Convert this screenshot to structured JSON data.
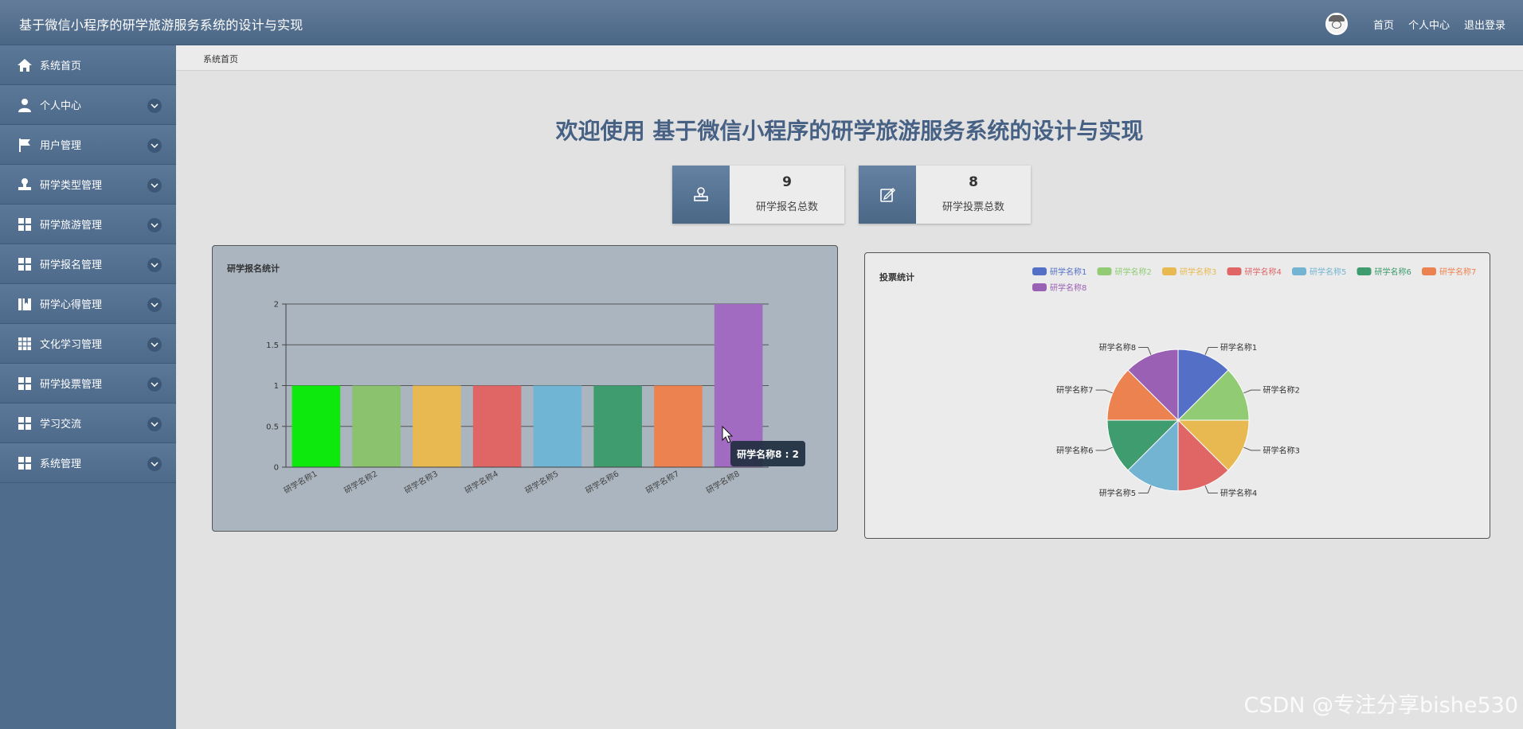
{
  "header": {
    "title": "基于微信小程序的研学旅游服务系统的设计与实现",
    "links": [
      "首页",
      "个人中心",
      "退出登录"
    ]
  },
  "sidebar": {
    "items": [
      {
        "label": "系统首页",
        "icon": "home-icon"
      },
      {
        "label": "个人中心",
        "icon": "user-icon"
      },
      {
        "label": "用户管理",
        "icon": "flag-icon"
      },
      {
        "label": "研学类型管理",
        "icon": "stamp-icon"
      },
      {
        "label": "研学旅游管理",
        "icon": "grid-icon"
      },
      {
        "label": "研学报名管理",
        "icon": "grid-icon"
      },
      {
        "label": "研学心得管理",
        "icon": "book-icon"
      },
      {
        "label": "文化学习管理",
        "icon": "grid9-icon"
      },
      {
        "label": "研学投票管理",
        "icon": "grid-icon"
      },
      {
        "label": "学习交流",
        "icon": "grid-icon"
      },
      {
        "label": "系统管理",
        "icon": "grid-icon"
      }
    ]
  },
  "breadcrumb": "系统首页",
  "welcome": "欢迎使用 基于微信小程序的研学旅游服务系统的设计与实现",
  "stats": [
    {
      "value": "9",
      "label": "研学报名总数",
      "icon": "stamp-icon"
    },
    {
      "value": "8",
      "label": "研学投票总数",
      "icon": "edit-icon"
    }
  ],
  "chart_data": [
    {
      "type": "bar",
      "title": "研学报名统计",
      "categories": [
        "研学名称1",
        "研学名称2",
        "研学名称3",
        "研学名称4",
        "研学名称5",
        "研学名称6",
        "研学名称7",
        "研学名称8"
      ],
      "values": [
        1,
        1,
        1,
        1,
        1,
        1,
        1,
        2
      ],
      "colors": [
        "#0de80d",
        "#8ac26e",
        "#e8b951",
        "#e06666",
        "#70b5d4",
        "#3e9c6e",
        "#ec8250",
        "#a06bc0"
      ],
      "yticks": [
        "0",
        "0.5",
        "1",
        "1.5",
        "2"
      ],
      "ylim": [
        0,
        2
      ],
      "grid": true,
      "tooltip": "研学名称8 : 2"
    },
    {
      "type": "pie",
      "title": "投票统计",
      "categories": [
        "研学名称1",
        "研学名称2",
        "研学名称3",
        "研学名称4",
        "研学名称5",
        "研学名称6",
        "研学名称7",
        "研学名称8"
      ],
      "values": [
        1,
        1,
        1,
        1,
        1,
        1,
        1,
        1
      ],
      "colors": [
        "#5470c6",
        "#91cc75",
        "#e8b951",
        "#e06666",
        "#73b4d2",
        "#3e9c6e",
        "#ec8250",
        "#9a60b4"
      ],
      "legend": "top-right"
    }
  ],
  "watermark": "CSDN @专注分享bishe530"
}
